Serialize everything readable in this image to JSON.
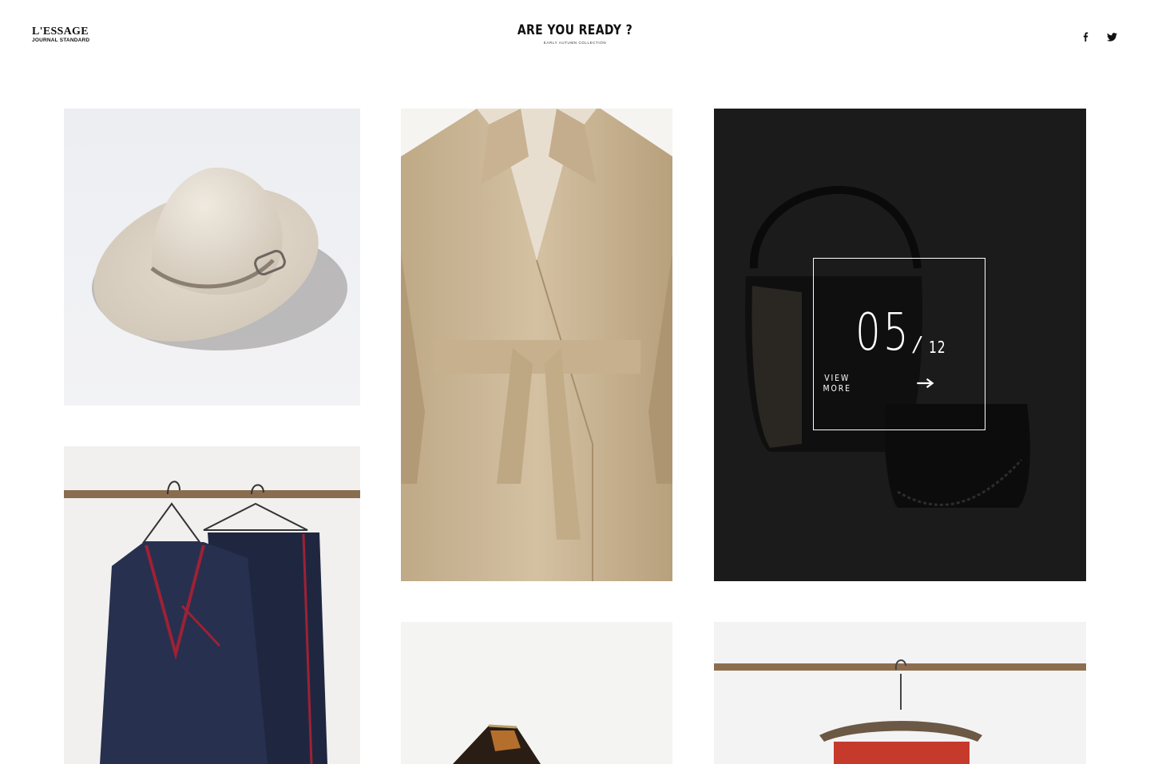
{
  "header": {
    "brand_name": "L'ESSAGE",
    "brand_sub": "JOURNAL STANDARD",
    "hero_title": "ARE YOU READY ?",
    "hero_subtitle": "EARLY AUTUMN COLLECTION",
    "social": [
      {
        "icon": "facebook-icon"
      },
      {
        "icon": "twitter-icon"
      }
    ]
  },
  "gallery": {
    "items": [
      {
        "subject": "hat-photo"
      },
      {
        "subject": "trench-coat-photo"
      },
      {
        "subject": "bucket-bag-photo"
      },
      {
        "subject": "pinstripe-pajama-set-photo"
      },
      {
        "subject": "shoes-photo"
      },
      {
        "subject": "skirt-on-hanger-photo"
      }
    ],
    "overlay": {
      "current": "05",
      "separator": "/",
      "total": "12",
      "view_more_label": "VIEW MORE",
      "arrow_icon": "arrow-right-icon"
    }
  },
  "colors": {
    "text": "#111111",
    "overlay_background": "#1b1b1c",
    "overlay_line": "#ffffff",
    "coat": "#cdbb9c"
  }
}
